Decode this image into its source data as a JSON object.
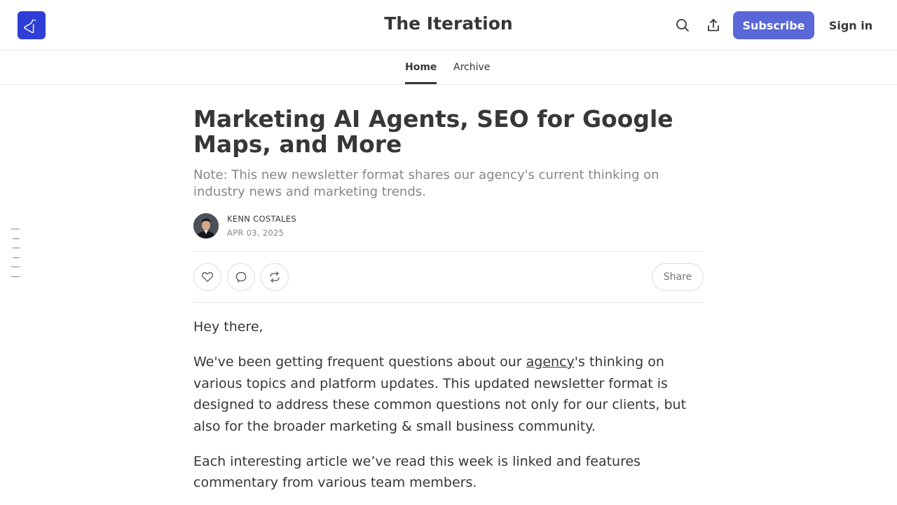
{
  "header": {
    "publication_title": "The Iteration",
    "subscribe_label": "Subscribe",
    "signin_label": "Sign in",
    "logo_icon": "flask-icon",
    "brand_color": "#2f3ed6",
    "accent_color": "#5a67d8"
  },
  "nav": {
    "tabs": [
      {
        "label": "Home",
        "active": true
      },
      {
        "label": "Archive",
        "active": false
      }
    ]
  },
  "article": {
    "title": "Marketing AI Agents, SEO for Google Maps, and More",
    "subtitle": "Note: This new newsletter format shares our agency's current thinking on industry news and marketing trends.",
    "author": "KENN COSTALES",
    "date": "APR 03, 2025",
    "share_label": "Share",
    "body": {
      "greeting": "Hey there,",
      "p1_before": "We've been getting frequent questions about our ",
      "p1_link": "agency",
      "p1_after": "'s thinking on various topics and platform updates. This updated newsletter format is designed to address these common questions not only for our clients, but also for the broader marketing & small business community.",
      "p2": "Each interesting article we’ve read this week is linked and features commentary from various team members."
    }
  }
}
